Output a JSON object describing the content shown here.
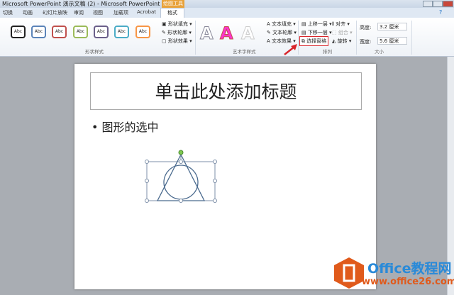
{
  "window": {
    "title": "Microsoft PowerPoint 演示文稿 (2) - Microsoft PowerPoint",
    "context_tab": "绘图工具"
  },
  "tabs": [
    "切换",
    "动画",
    "幻灯片放映",
    "审阅",
    "视图",
    "加载项",
    "Acrobat",
    "格式"
  ],
  "ribbon": {
    "shape_styles": {
      "label": "形状样式",
      "swatch_text": "Abc",
      "swatch_colors": [
        "#222222",
        "#5b84b8",
        "#c0504d",
        "#9bbb59",
        "#6a5f8a",
        "#4bacc6",
        "#f79646"
      ],
      "fill": "形状填充",
      "outline": "形状轮廓",
      "effects": "形状效果"
    },
    "wordart": {
      "label": "艺术字样式",
      "glyph": "A",
      "fill": "文本填充",
      "outline": "文本轮廓",
      "effects": "文本效果"
    },
    "arrange": {
      "label": "排列",
      "bring_forward": "上移一层",
      "send_backward": "下移一层",
      "selection_pane": "选择窗格",
      "align": "对齐",
      "group": "组合",
      "rotate": "旋转"
    },
    "size": {
      "label": "大小",
      "height_label": "高度:",
      "height_value": "3.2 厘米",
      "width_label": "宽度:",
      "width_value": "5.6 厘米"
    }
  },
  "slide": {
    "title_placeholder": "单击此处添加标题",
    "bullet": "图形的选中"
  },
  "watermark": {
    "brand": "Office教程网",
    "url": "www.office26.com"
  },
  "colors": {
    "accent": "#e8a23a",
    "highlight": "#d9262b",
    "logo": "#e05a1b",
    "brand_text": "#2a8ad8"
  }
}
